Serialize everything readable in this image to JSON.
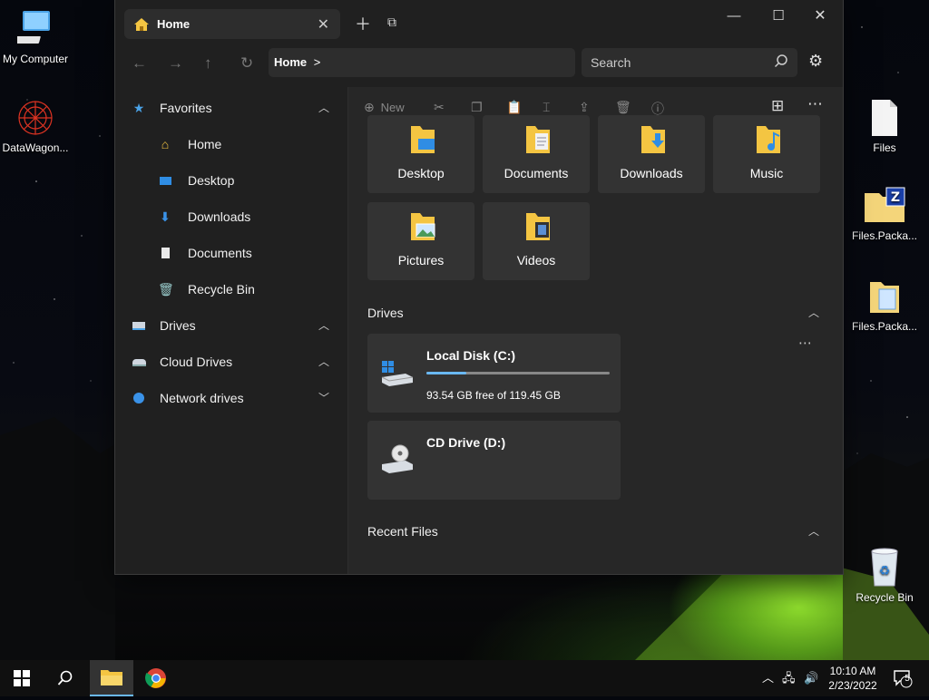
{
  "desktop": {
    "left_icons": [
      {
        "label": "My Computer",
        "icon": "computer-icon"
      },
      {
        "label": "DataWagon...",
        "icon": "datawagon-icon"
      }
    ],
    "right_icons": [
      {
        "label": "Files",
        "icon": "file-icon"
      },
      {
        "label": "Files.Packa...",
        "icon": "package-icon"
      },
      {
        "label": "Files.Packa...",
        "icon": "package-folder-icon"
      },
      {
        "label": "Recycle Bin",
        "icon": "recycle-bin-icon"
      }
    ]
  },
  "window": {
    "tab": {
      "label": "Home",
      "icon": "home-icon"
    },
    "controls": {
      "minimize": "—",
      "maximize": "☐",
      "close": "✕"
    },
    "address": {
      "crumb": "Home",
      "sep": ">"
    },
    "search": {
      "placeholder": "Search"
    },
    "sidebar": {
      "favorites": {
        "label": "Favorites",
        "expanded": true
      },
      "favorites_items": [
        {
          "label": "Home",
          "icon": "home-icon"
        },
        {
          "label": "Desktop",
          "icon": "desktop-icon"
        },
        {
          "label": "Downloads",
          "icon": "download-icon"
        },
        {
          "label": "Documents",
          "icon": "document-icon"
        },
        {
          "label": "Recycle Bin",
          "icon": "recycle-bin-icon"
        }
      ],
      "sections": [
        {
          "label": "Drives",
          "icon": "drive-icon",
          "expanded": true
        },
        {
          "label": "Cloud Drives",
          "icon": "cloud-drive-icon",
          "expanded": true
        },
        {
          "label": "Network drives",
          "icon": "network-icon",
          "expanded": false
        }
      ]
    },
    "toolbar": {
      "new_label": "New"
    },
    "folders": [
      {
        "label": "Desktop"
      },
      {
        "label": "Documents"
      },
      {
        "label": "Downloads"
      },
      {
        "label": "Music"
      },
      {
        "label": "Pictures"
      },
      {
        "label": "Videos"
      }
    ],
    "drives_header": "Drives",
    "drives": [
      {
        "name": "Local Disk (C:)",
        "free": "93.54 GB free of 119.45 GB",
        "used_fraction": 0.217
      },
      {
        "name": "CD Drive (D:)",
        "free": ""
      }
    ],
    "recent_header": "Recent Files"
  },
  "taskbar": {
    "time": "10:10 AM",
    "date": "2/23/2022",
    "notifications": "5"
  },
  "colors": {
    "accent": "#6ab8f2",
    "window_bg": "#202020",
    "content_bg": "#272727",
    "folder_yellow": "#f4c542"
  }
}
